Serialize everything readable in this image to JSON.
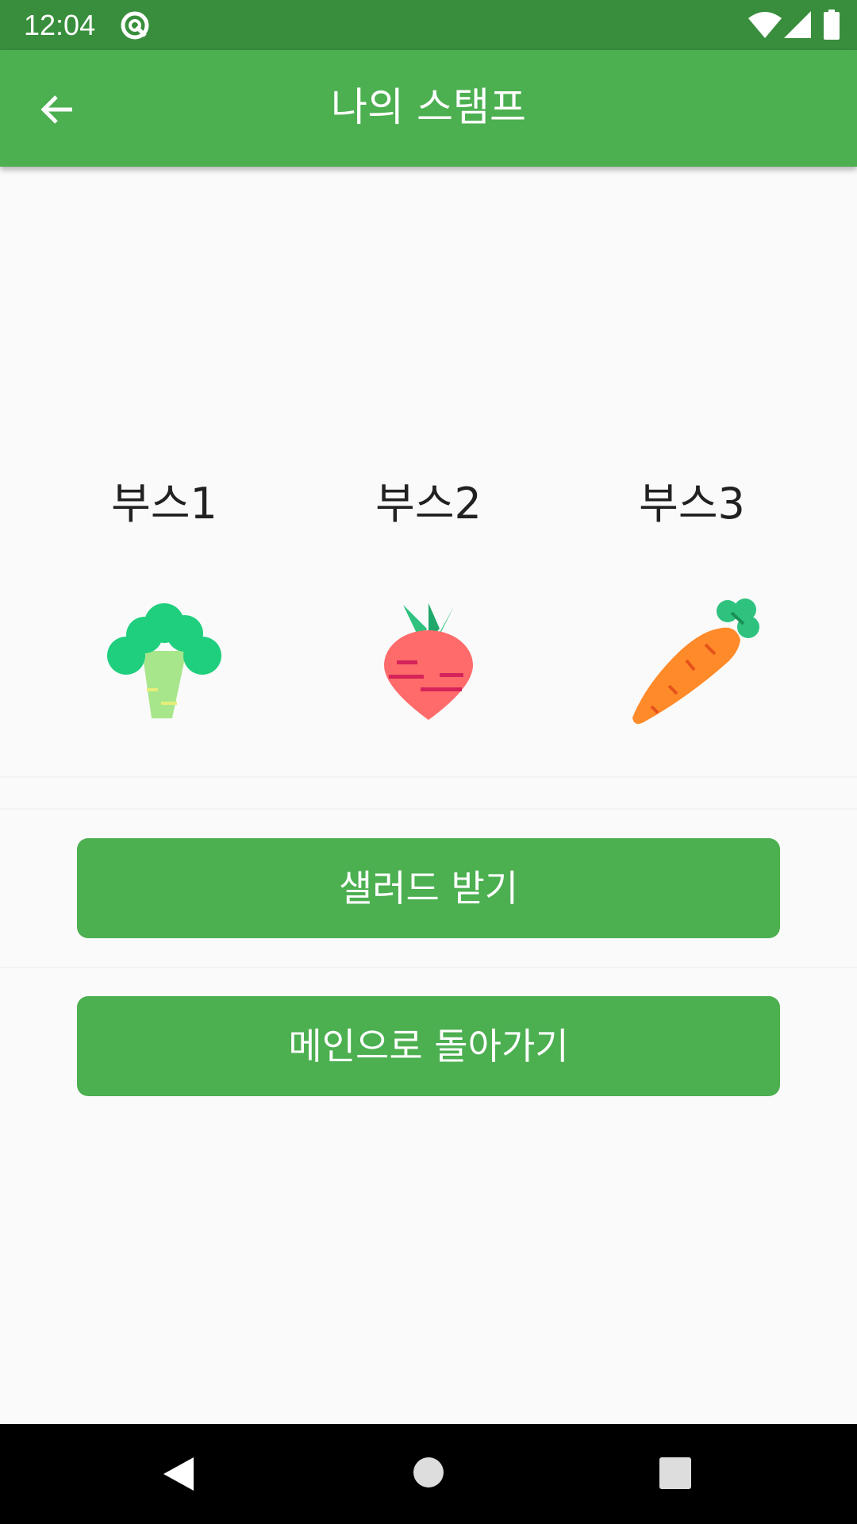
{
  "status_bar": {
    "time": "12:04",
    "icons": [
      "sync-icon",
      "wifi-icon",
      "signal-icon",
      "battery-icon"
    ]
  },
  "app_bar": {
    "back_icon": "arrow-left-icon",
    "title": "나의 스탬프"
  },
  "booths": [
    {
      "label": "부스1",
      "icon": "broccoli-icon"
    },
    {
      "label": "부스2",
      "icon": "radish-icon"
    },
    {
      "label": "부스3",
      "icon": "carrot-icon"
    }
  ],
  "buttons": {
    "get_salad": "샐러드 받기",
    "go_main": "메인으로 돌아가기"
  },
  "nav_bar": {
    "icons": [
      "back-triangle-icon",
      "home-circle-icon",
      "recents-square-icon"
    ]
  },
  "colors": {
    "status_bar": "#388e3c",
    "primary": "#4caf50",
    "background": "#fafafa"
  }
}
